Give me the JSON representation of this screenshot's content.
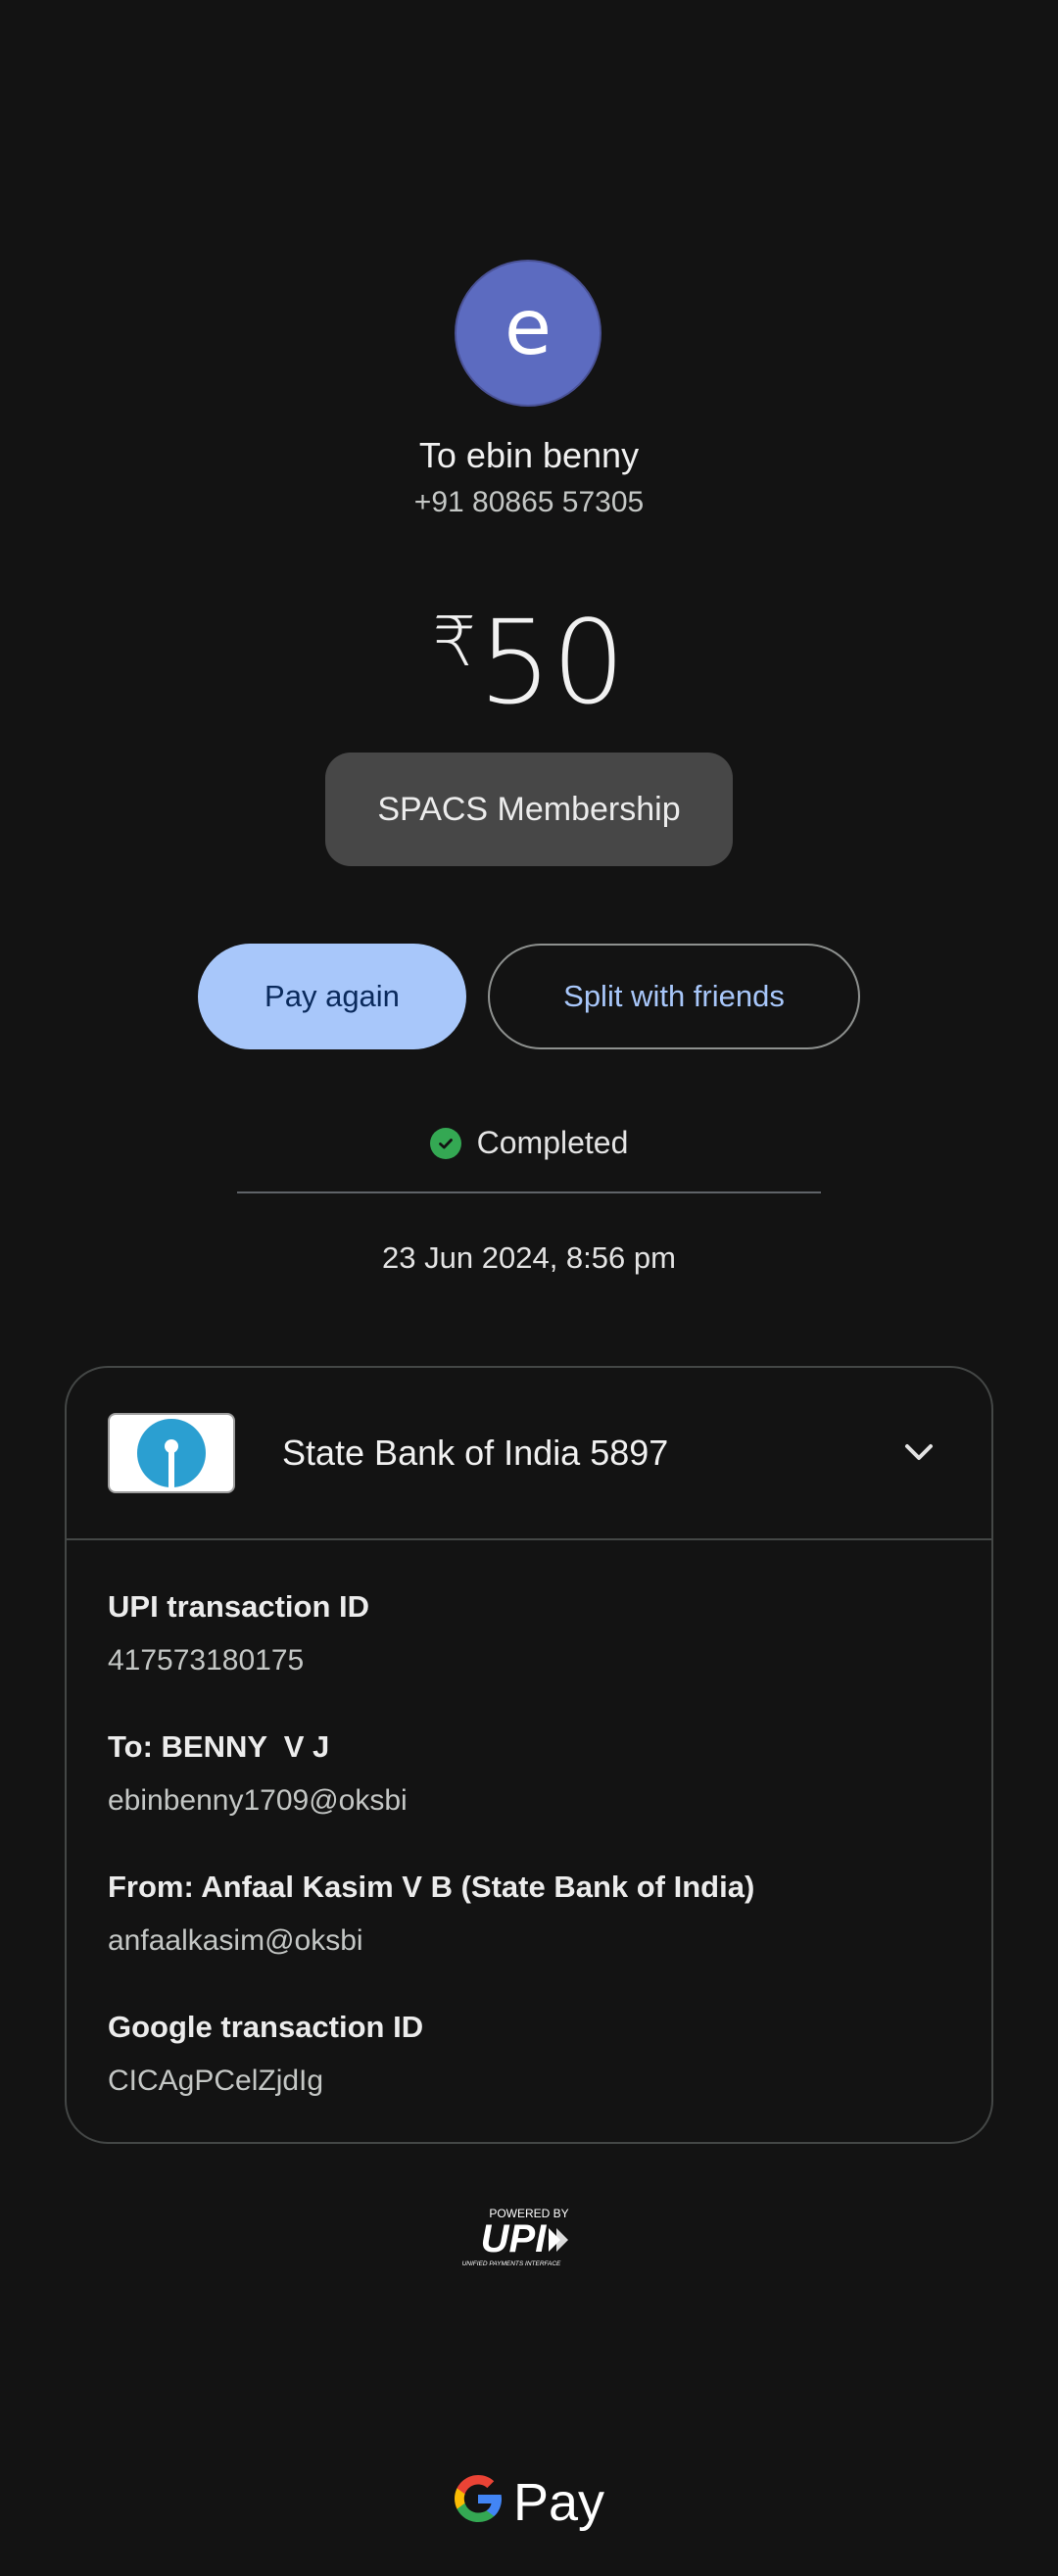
{
  "recipient": {
    "avatar_letter": "e",
    "to_label": "To ebin benny",
    "phone": "+91 80865 57305"
  },
  "payment": {
    "currency_symbol": "₹",
    "amount": "50",
    "note": "SPACS Membership"
  },
  "actions": {
    "pay_again": "Pay again",
    "split": "Split with friends"
  },
  "status": {
    "text": "Completed",
    "datetime": "23 Jun 2024, 8:56 pm"
  },
  "bank": {
    "name": "State Bank of India 5897"
  },
  "details": [
    {
      "label": "UPI transaction ID",
      "value": "417573180175"
    },
    {
      "label": "To: BENNY  V J",
      "value": "ebinbenny1709@oksbi"
    },
    {
      "label": "From: Anfaal Kasim V B (State Bank of India)",
      "value": "anfaalkasim@oksbi"
    },
    {
      "label": "Google transaction ID",
      "value": "CICAgPCelZjdIg"
    }
  ],
  "footer": {
    "upi_powered": "POWERED BY",
    "upi_text": "UPI",
    "upi_sub": "UNIFIED PAYMENTS INTERFACE",
    "gpay_text": "Pay"
  },
  "colors": {
    "background": "#131313",
    "avatar": "#5c6bc0",
    "primary_button": "#a8c7fa",
    "status_green": "#34a853",
    "sbi_blue": "#2b9fd1"
  },
  "icons": [
    "check-icon",
    "chevron-down-icon",
    "sbi-logo",
    "upi-logo",
    "google-g-logo"
  ]
}
